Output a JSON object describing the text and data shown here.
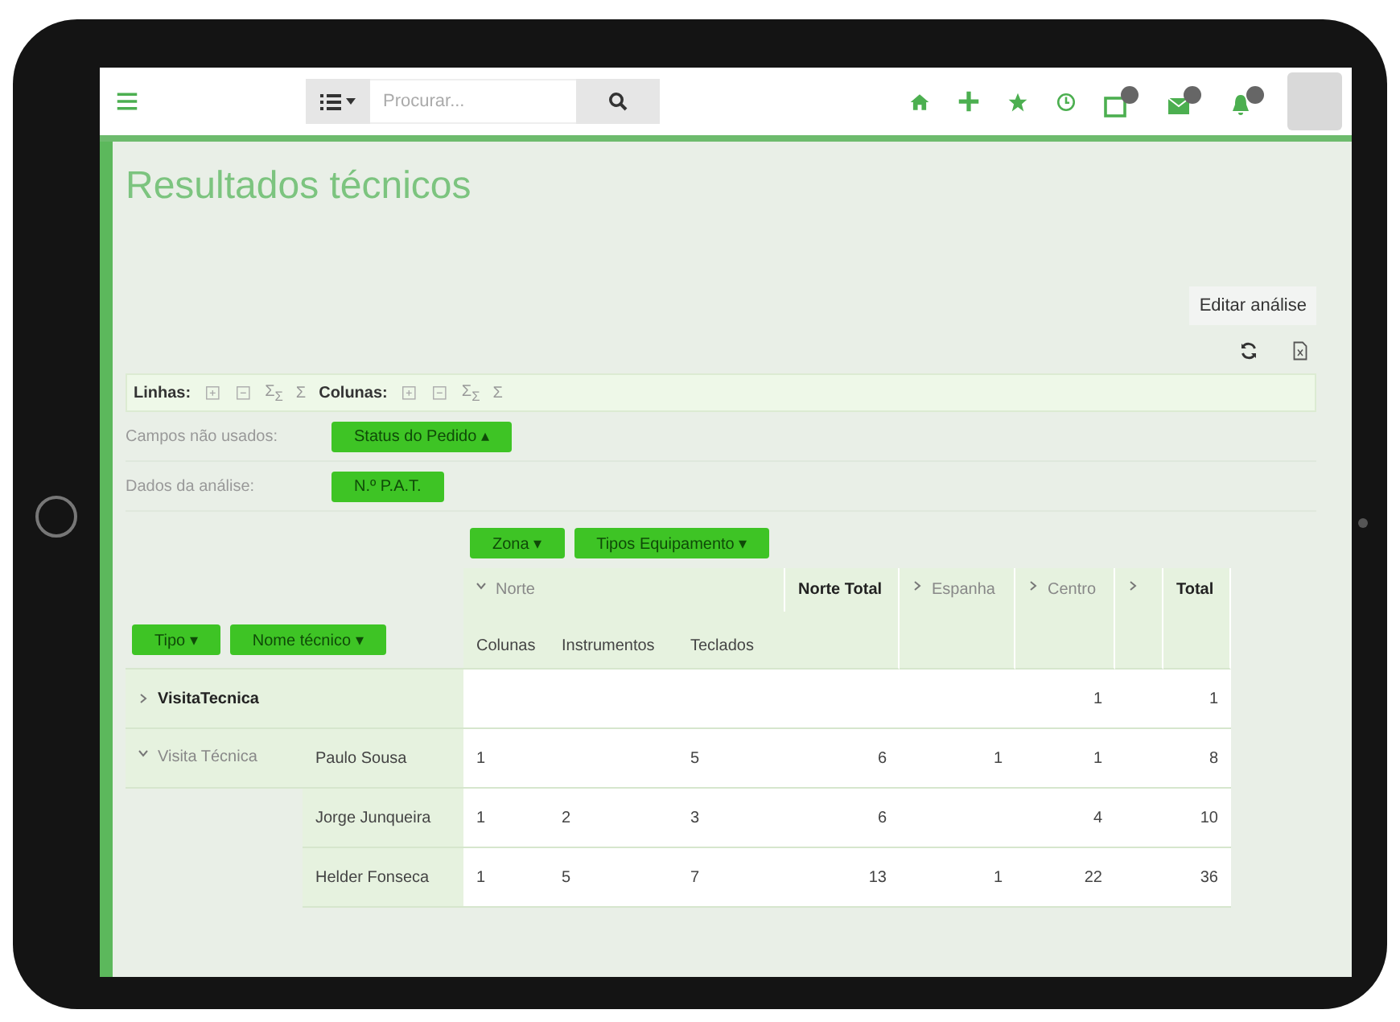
{
  "topbar": {
    "search": {
      "placeholder": "Procurar..."
    }
  },
  "title": "Resultados técnicos",
  "edit_button": "Editar análise",
  "toolbar": [
    {
      "label": "Linhas:",
      "tools": [
        {
          "kind": "expand"
        },
        {
          "kind": "collapse"
        },
        {
          "kind": "text",
          "text": "Σ$_{Σ}$"
        },
        {
          "kind": "text",
          "text": "Σ"
        }
      ]
    },
    {
      "label": "Colunas:",
      "tools": [
        {
          "kind": "expand"
        },
        {
          "kind": "collapse"
        },
        {
          "kind": "text",
          "text": "Σ$_{Σ}$"
        },
        {
          "kind": "text",
          "text": "Σ"
        }
      ]
    }
  ],
  "unused_fields": {
    "label": "Campos não usados:",
    "pills": [
      {
        "label": "Status do Pedido",
        "caret": "▴"
      }
    ]
  },
  "analysis_data": {
    "label": "Dados da análise:",
    "pills": [
      {
        "label": "N.º P.A.T."
      }
    ]
  },
  "column_fields": [
    {
      "label": "Zona",
      "caret": "▾"
    },
    {
      "label": "Tipos Equipamento",
      "caret": "▾"
    }
  ],
  "row_fields": [
    {
      "label": "Tipo",
      "caret": "▾"
    },
    {
      "label": "Nome técnico",
      "caret": "▾"
    }
  ],
  "table": {
    "columns": [
      {
        "kind": "group",
        "label": "Norte",
        "expanded": true,
        "children": [
          "Colunas",
          "Instrumentos",
          "Teclados"
        ]
      },
      {
        "kind": "total",
        "label": "Norte Total"
      },
      {
        "kind": "group",
        "label": "Espanha",
        "expanded": false
      },
      {
        "kind": "group",
        "label": "Centro",
        "expanded": false
      },
      {
        "kind": "group",
        "expanded": false
      },
      {
        "kind": "total",
        "label": "Total"
      }
    ],
    "rows": [
      {
        "label": "VisitaTecnica",
        "expanded": false,
        "cells": [
          null,
          null,
          null,
          null,
          null,
          "1",
          null,
          "1"
        ]
      },
      {
        "label": "Visita Técnica",
        "expanded": true,
        "children": [
          {
            "label": "Paulo Sousa",
            "cells": [
              "1",
              null,
              "5",
              "6",
              "1",
              "1",
              null,
              "8"
            ]
          },
          {
            "label": "Jorge Junqueira",
            "cells": [
              "1",
              "2",
              "3",
              "6",
              null,
              "4",
              null,
              "10"
            ]
          },
          {
            "label": "Helder Fonseca",
            "cells": [
              "1",
              "5",
              "7",
              "13",
              "1",
              "22",
              null,
              "36"
            ]
          }
        ]
      }
    ]
  }
}
